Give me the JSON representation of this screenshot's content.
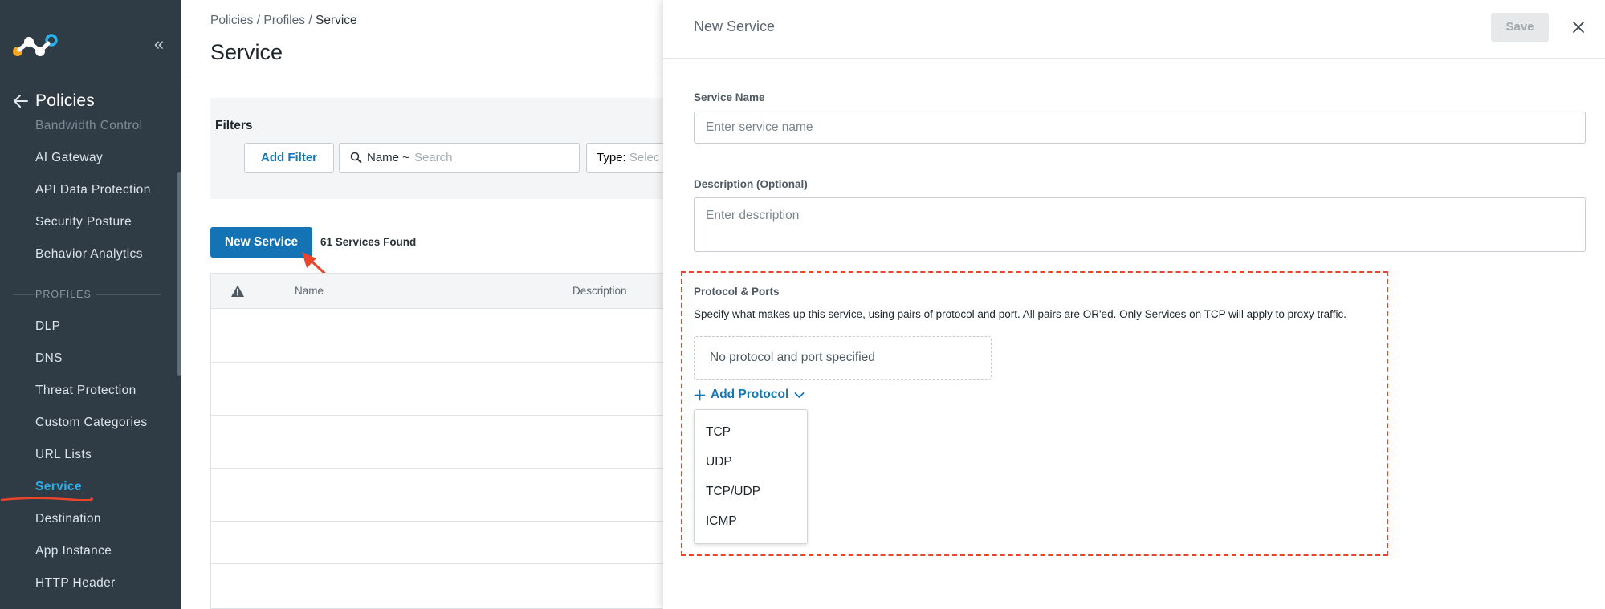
{
  "sidebar": {
    "back_title": "Policies",
    "items": [
      {
        "label": "Bandwidth Control"
      },
      {
        "label": "AI Gateway"
      },
      {
        "label": "API Data Protection"
      },
      {
        "label": "Security Posture"
      },
      {
        "label": "Behavior Analytics"
      }
    ],
    "profiles_header": "PROFILES",
    "profile_items": [
      {
        "label": "DLP"
      },
      {
        "label": "DNS"
      },
      {
        "label": "Threat Protection"
      },
      {
        "label": "Custom Categories"
      },
      {
        "label": "URL Lists"
      },
      {
        "label": "Service"
      },
      {
        "label": "Destination"
      },
      {
        "label": "App Instance"
      },
      {
        "label": "HTTP Header"
      }
    ],
    "active_item": "Service",
    "colors": {
      "background": "#2f3c46",
      "active": "#29b2ea"
    }
  },
  "page": {
    "breadcrumb": {
      "item1": "Policies",
      "sep": "/",
      "item2": "Profiles",
      "current": "Service"
    },
    "title": "Service",
    "filters": {
      "title": "Filters",
      "add_filter": "Add Filter",
      "name_label": "Name ~",
      "name_placeholder": "Search",
      "type_label": "Type:",
      "type_placeholder": "Selec"
    },
    "new_service_button": "New Service",
    "found_count": "61 Services Found",
    "table": {
      "columns": [
        "Name",
        "Description"
      ]
    },
    "accent_color": "#1473b5"
  },
  "drawer": {
    "title": "New Service",
    "save_label": "Save",
    "service_name": {
      "label": "Service Name",
      "placeholder": "Enter service name",
      "value": ""
    },
    "description": {
      "label": "Description (Optional)",
      "placeholder": "Enter description",
      "value": ""
    },
    "protocol": {
      "title": "Protocol & Ports",
      "description": "Specify what makes up this service, using pairs of protocol and port. All pairs are OR'ed. Only Services on TCP will apply to proxy traffic.",
      "empty_text": "No protocol and port specified",
      "add_label": "Add Protocol",
      "options": [
        {
          "label": "TCP"
        },
        {
          "label": "UDP"
        },
        {
          "label": "TCP/UDP"
        },
        {
          "label": "ICMP"
        }
      ]
    },
    "highlight_color": "#e8452a"
  }
}
